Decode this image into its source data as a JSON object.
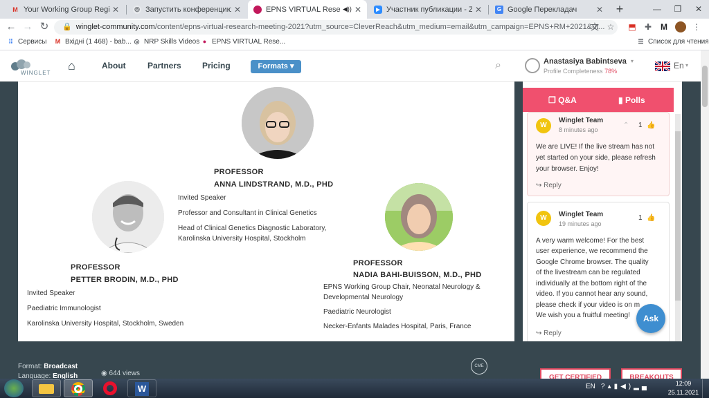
{
  "browser": {
    "tabs": [
      {
        "title": "Your Working Group Registratio",
        "favicon": "M",
        "favicon_color": "#d93025"
      },
      {
        "title": "Запустить конференцию - Zoo",
        "favicon": "",
        "favicon_color": "#5f6368"
      },
      {
        "title": "EPNS VIRTUAL Research Me",
        "favicon": "",
        "favicon_color": "#c2185b",
        "active": true
      },
      {
        "title": "Участник публикации - Zoom",
        "favicon": "",
        "favicon_color": "#2d8cff"
      },
      {
        "title": "Google Перекладач",
        "favicon": "",
        "favicon_color": "#4285f4"
      }
    ],
    "url_host": "winglet-community.com",
    "url_rest": "/content/epns-virtual-research-meeting-2021?utm_source=CleverReach&utm_medium=email&utm_campaign=EPNS+RM+2021&ut...",
    "bookmarks": [
      {
        "label": "Сервисы",
        "icon": "apps-icon"
      },
      {
        "label": "Вхідні (1 468) - bab...",
        "icon": "gmail-icon"
      },
      {
        "label": "NRP Skills Videos",
        "icon": "globe-icon"
      },
      {
        "label": "EPNS VIRTUAL Rese...",
        "icon": "epns-icon"
      }
    ],
    "reading_list": "Список для чтения"
  },
  "site": {
    "logo_text": "WINGLET",
    "nav": {
      "about": "About",
      "partners": "Partners",
      "pricing": "Pricing",
      "formats": "Formats ▾"
    },
    "user": {
      "name": "Anastasiya Babintseva",
      "completeness_label": "Profile Completeness",
      "completeness_value": "78%"
    },
    "lang": "En"
  },
  "speakers": [
    {
      "title": "PROFESSOR",
      "name": "ANNA LINDSTRAND, M.D., PHD",
      "lines": [
        "Invited Speaker",
        "Professor and Consultant in Clinical Genetics",
        "Head of Clinical Genetics Diagnostic Laboratory,",
        "Karolinska University Hospital, Stockholm"
      ]
    },
    {
      "title": "PROFESSOR",
      "name": "PETTER BRODIN, M.D., PHD",
      "lines": [
        "Invited Speaker",
        "Paediatric Immunologist",
        "Karolinska University Hospital, Stockholm, Sweden"
      ]
    },
    {
      "title": "PROFESSOR",
      "name": "NADIA BAHI-BUISSON, M.D., PHD",
      "lines": [
        "EPNS Working Group Chair, Neonatal Neurology &",
        "Developmental Neurology",
        "Paediatric Neurologist",
        "Necker-Enfants Malades Hospital, Paris, France"
      ]
    }
  ],
  "chat": {
    "tabs": {
      "qa": "Q&A",
      "polls": "Polls"
    },
    "messages": [
      {
        "author": "Winglet Team",
        "time": "8 minutes ago",
        "likes": "1",
        "lines": [
          "We are LIVE! If the live stream has not",
          "yet started on your side, please refresh",
          "your browser. Enjoy!"
        ],
        "reply": "Reply"
      },
      {
        "author": "Winglet Team",
        "time": "19 minutes ago",
        "likes": "1",
        "lines": [
          "A very warm welcome! For the best",
          "user experience, we recommend the",
          "Google Chrome browser. The quality",
          "of the livestream can be regulated",
          "individually at the bottom right of the",
          "video. If you cannot hear any sound,",
          "please check if your video is on m",
          "We wish you a fruitful meeting!"
        ],
        "reply": "Reply"
      }
    ],
    "ask": "Ask",
    "avatar_letter": "W"
  },
  "footer": {
    "format_label": "Format:",
    "format_value": "Broadcast",
    "language_label": "Language:",
    "language_value": "English",
    "views": "644 views",
    "badge": "CME",
    "cert_button": "GET CERTIFIED",
    "breakouts_button": "BREAKOUTS"
  },
  "taskbar": {
    "lang": "EN",
    "time": "12:09",
    "date": "25.11.2021"
  },
  "colors": {
    "accent": "#f0506e",
    "nav_blue": "#4a90c8",
    "ask_blue": "#3e8ed0",
    "dark": "#37474f"
  }
}
